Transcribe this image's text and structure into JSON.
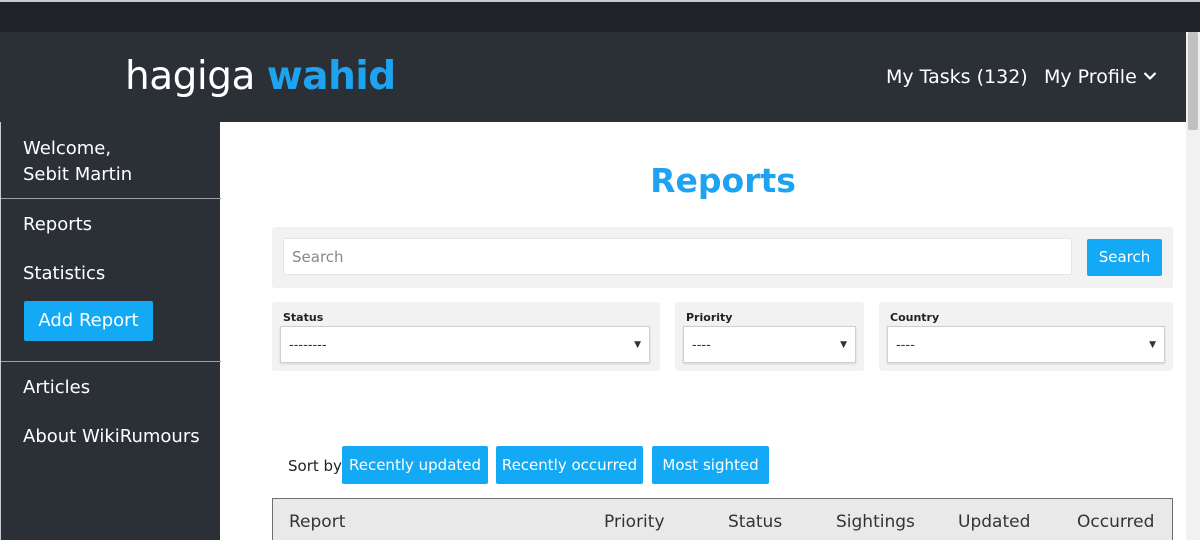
{
  "header": {
    "logo_light": "hagiga",
    "logo_bold": "wahid",
    "nav": {
      "tasks": "My Tasks (132)",
      "profile": "My Profile"
    }
  },
  "sidebar": {
    "welcome_line1": "Welcome,",
    "welcome_line2": "Sebit Martin",
    "items": {
      "reports": "Reports",
      "statistics": "Statistics",
      "add_report": "Add Report",
      "articles": "Articles",
      "about": "About WikiRumours"
    }
  },
  "main": {
    "title": "Reports",
    "search": {
      "placeholder": "Search",
      "button": "Search"
    },
    "filters": {
      "status": {
        "label": "Status",
        "value": "--------"
      },
      "priority": {
        "label": "Priority",
        "value": "----"
      },
      "country": {
        "label": "Country",
        "value": "----"
      }
    },
    "sort": {
      "label": "Sort by",
      "buttons": {
        "recently_updated": "Recently updated",
        "recently_occurred": "Recently occurred",
        "most_sighted": "Most sighted"
      }
    },
    "table": {
      "columns": {
        "report": "Report",
        "priority": "Priority",
        "status": "Status",
        "sightings": "Sightings",
        "updated": "Updated",
        "occurred": "Occurred"
      }
    }
  },
  "colors": {
    "accent": "#14a9f5",
    "logo_blue": "#1ea3f0",
    "nav_bg": "#2b3037"
  }
}
